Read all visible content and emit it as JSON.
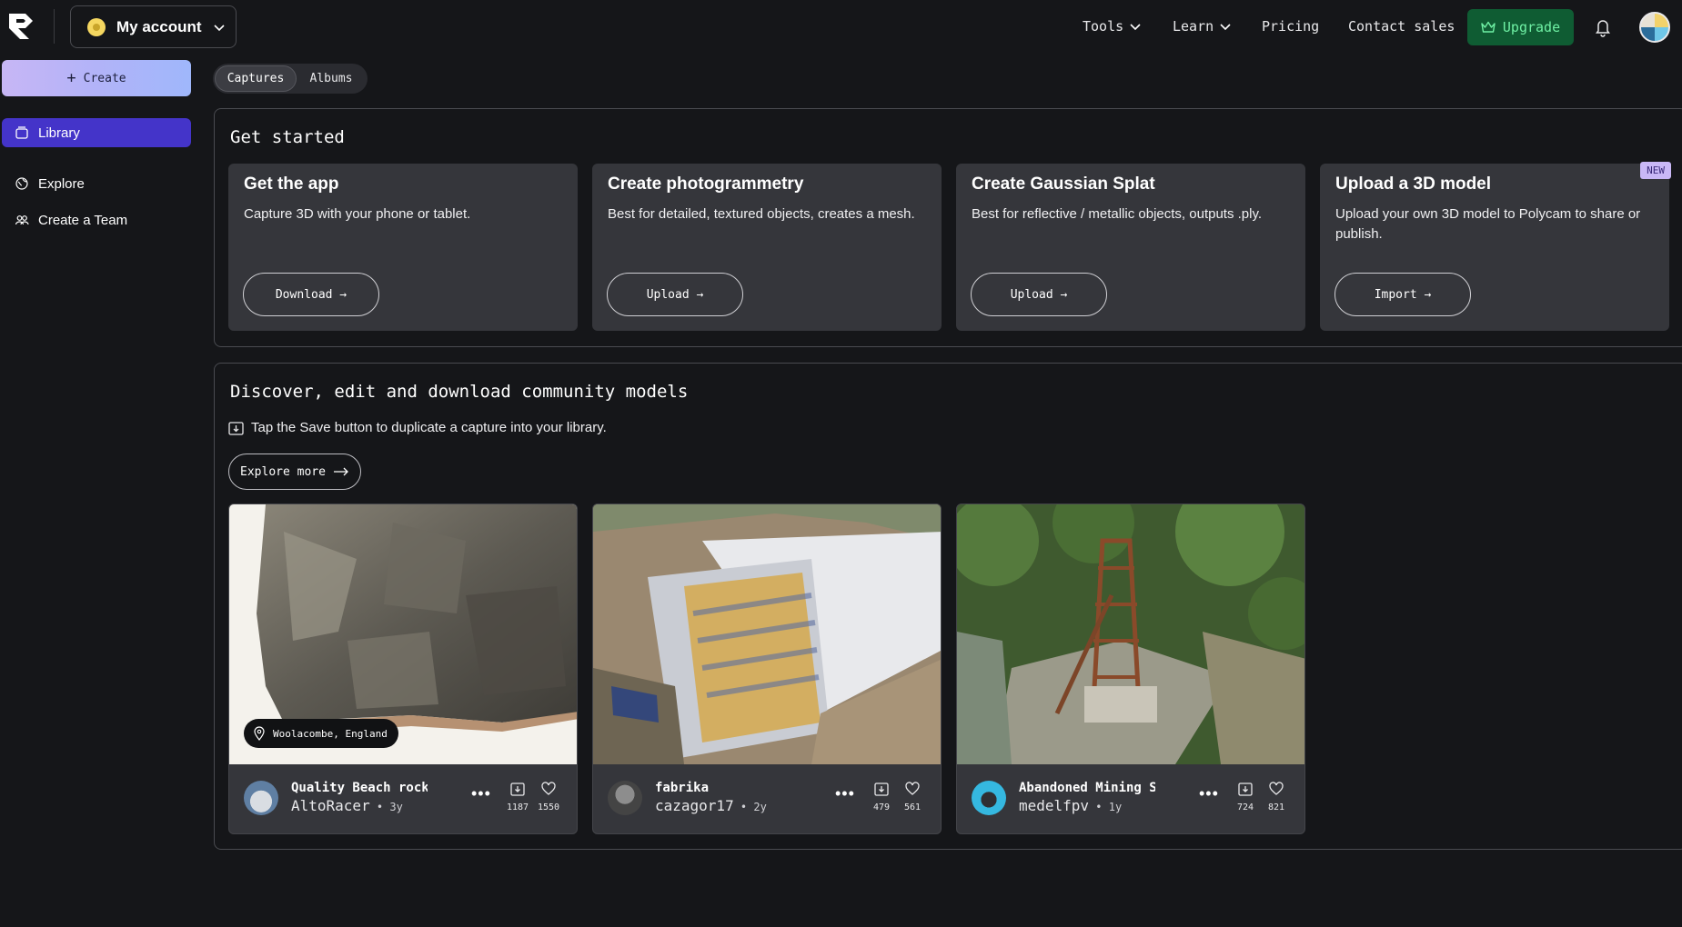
{
  "header": {
    "account_label": "My account",
    "nav": {
      "tools": "Tools",
      "learn": "Learn",
      "pricing": "Pricing",
      "contact": "Contact sales",
      "upgrade": "Upgrade"
    }
  },
  "sidebar": {
    "create_label": "Create",
    "items": [
      {
        "label": "Library",
        "icon": "library-icon",
        "active": true
      },
      {
        "label": "Explore",
        "icon": "globe-icon"
      },
      {
        "label": "Create a Team",
        "icon": "team-icon"
      }
    ]
  },
  "tabs": [
    "Captures",
    "Albums"
  ],
  "get_started": {
    "title": "Get started",
    "cards": [
      {
        "title": "Get the app",
        "desc": "Capture 3D with your phone or tablet.",
        "button": "Download →"
      },
      {
        "title": "Create photogrammetry",
        "desc": "Best for detailed, textured objects, creates a mesh.",
        "button": "Upload →"
      },
      {
        "title": "Create Gaussian Splat",
        "desc": "Best for reflective / metallic objects, outputs .ply.",
        "button": "Upload →"
      },
      {
        "title": "Upload a 3D model",
        "desc": "Upload your own 3D model to Polycam to share or publish.",
        "button": "Import →",
        "badge": "NEW"
      }
    ]
  },
  "community": {
    "title": "Discover, edit and download community models",
    "hint": "Tap the Save button to duplicate a capture into your library.",
    "explore_label": "Explore more",
    "models": [
      {
        "title": "Quality Beach rock",
        "author": "AltoRacer",
        "age": "3y",
        "saves": "1187",
        "likes": "1550",
        "location": "Woolacombe, England"
      },
      {
        "title": "fabrika",
        "author": "cazagor17",
        "age": "2y",
        "saves": "479",
        "likes": "561"
      },
      {
        "title": "Abandoned Mining S",
        "author": "medelfpv",
        "age": "1y",
        "saves": "724",
        "likes": "821"
      }
    ]
  },
  "colors": {
    "background": "#151619",
    "card": "#35363b",
    "accent_active": "#4434c9",
    "upgrade_bg": "#0f5c33",
    "upgrade_text": "#6ff0a4",
    "new_badge": "#c9b8f6"
  }
}
